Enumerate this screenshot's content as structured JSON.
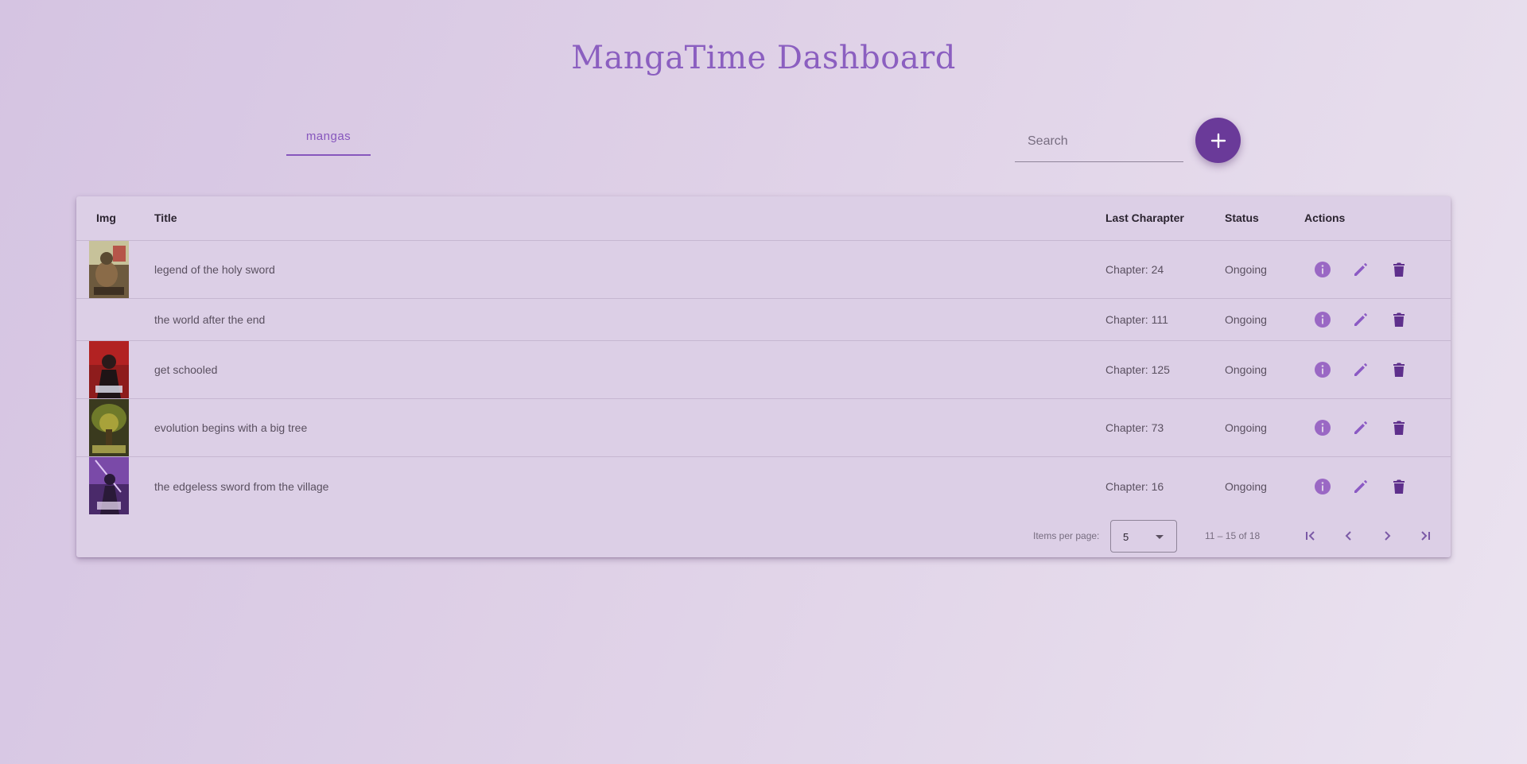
{
  "page_title": "MangaTime Dashboard",
  "tabs": [
    {
      "label": "mangas"
    }
  ],
  "search": {
    "placeholder": "Search",
    "value": ""
  },
  "add_button": {
    "icon": "plus-icon"
  },
  "table": {
    "columns": [
      "Img",
      "Title",
      "Last Charapter",
      "Status",
      "Actions"
    ],
    "rows": [
      {
        "title": "legend of the holy sword",
        "last_chapter": "Chapter: 24",
        "status": "Ongoing",
        "has_image": true
      },
      {
        "title": "the world after the end",
        "last_chapter": "Chapter: 111",
        "status": "Ongoing",
        "has_image": false
      },
      {
        "title": "get schooled",
        "last_chapter": "Chapter: 125",
        "status": "Ongoing",
        "has_image": true
      },
      {
        "title": "evolution begins with a big tree",
        "last_chapter": "Chapter: 73",
        "status": "Ongoing",
        "has_image": true
      },
      {
        "title": "the edgeless sword from the village",
        "last_chapter": "Chapter: 16",
        "status": "Ongoing",
        "has_image": true
      }
    ],
    "actions": [
      "info-icon",
      "edit-icon",
      "delete-icon"
    ]
  },
  "paginator": {
    "items_per_page_label": "Items per page:",
    "page_size": "5",
    "range_label": "11 – 15 of 18"
  },
  "colors": {
    "accent": "#8757bd",
    "fab": "#6a3a99",
    "info_icon": "#9a68c4",
    "edit_icon": "#8b5ac4",
    "delete_icon": "#5e2f8c"
  }
}
